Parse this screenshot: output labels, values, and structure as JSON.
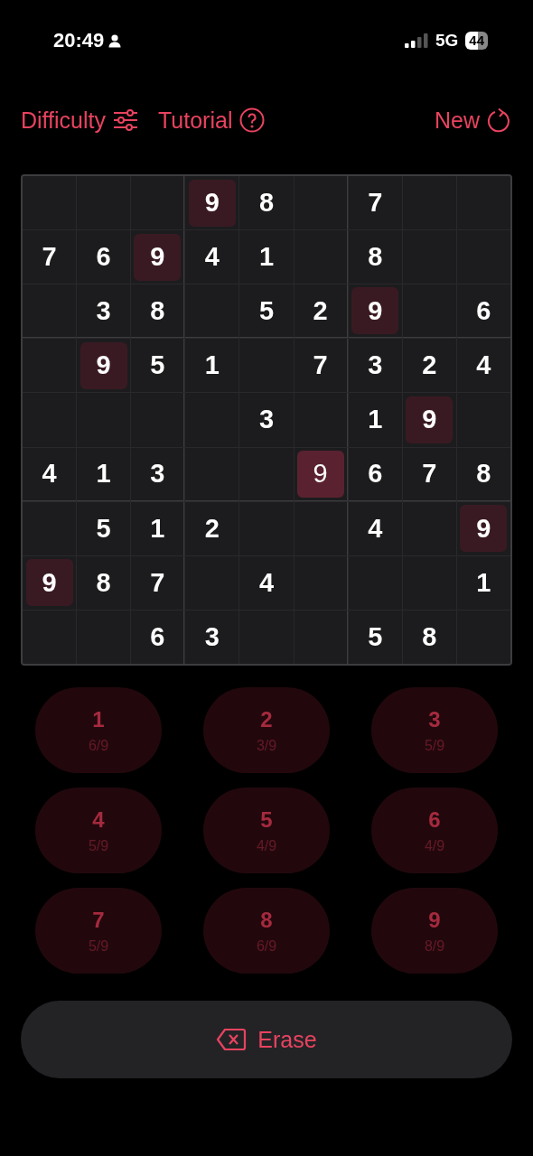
{
  "status_bar": {
    "time": "20:49",
    "network": "5G",
    "battery": "44"
  },
  "toolbar": [
    {
      "kind": "difficulty",
      "label": "Difficulty"
    },
    {
      "kind": "tutorial",
      "label": "Tutorial"
    },
    {
      "kind": "new",
      "label": "New"
    }
  ],
  "grid": [
    [
      {
        "kind": "empty"
      },
      {
        "kind": "empty"
      },
      {
        "kind": "empty"
      },
      {
        "digit": "9",
        "kind": "given",
        "highlighted": true
      },
      {
        "digit": "8",
        "kind": "given",
        "highlighted": false
      },
      {
        "kind": "empty"
      },
      {
        "digit": "7",
        "kind": "given",
        "highlighted": false
      },
      {
        "kind": "empty"
      },
      {
        "kind": "empty"
      }
    ],
    [
      {
        "digit": "7",
        "kind": "given",
        "highlighted": false
      },
      {
        "digit": "6",
        "kind": "given",
        "highlighted": false
      },
      {
        "digit": "9",
        "kind": "given",
        "highlighted": true
      },
      {
        "digit": "4",
        "kind": "given",
        "highlighted": false
      },
      {
        "digit": "1",
        "kind": "given",
        "highlighted": false
      },
      {
        "kind": "empty"
      },
      {
        "digit": "8",
        "kind": "given",
        "highlighted": false
      },
      {
        "kind": "empty"
      },
      {
        "kind": "empty"
      }
    ],
    [
      {
        "kind": "empty"
      },
      {
        "digit": "3",
        "kind": "given",
        "highlighted": false
      },
      {
        "digit": "8",
        "kind": "given",
        "highlighted": false
      },
      {
        "kind": "empty"
      },
      {
        "digit": "5",
        "kind": "given",
        "highlighted": false
      },
      {
        "digit": "2",
        "kind": "given",
        "highlighted": false
      },
      {
        "digit": "9",
        "kind": "given",
        "highlighted": true
      },
      {
        "kind": "empty"
      },
      {
        "digit": "6",
        "kind": "given",
        "highlighted": false
      }
    ],
    [
      {
        "kind": "empty"
      },
      {
        "digit": "9",
        "kind": "given",
        "highlighted": true
      },
      {
        "digit": "5",
        "kind": "given",
        "highlighted": false
      },
      {
        "digit": "1",
        "kind": "given",
        "highlighted": false
      },
      {
        "kind": "empty"
      },
      {
        "digit": "7",
        "kind": "given",
        "highlighted": false
      },
      {
        "digit": "3",
        "kind": "given",
        "highlighted": false
      },
      {
        "digit": "2",
        "kind": "given",
        "highlighted": false
      },
      {
        "digit": "4",
        "kind": "given",
        "highlighted": false
      }
    ],
    [
      {
        "kind": "empty"
      },
      {
        "kind": "empty"
      },
      {
        "kind": "empty"
      },
      {
        "kind": "empty"
      },
      {
        "digit": "3",
        "kind": "given",
        "highlighted": false
      },
      {
        "kind": "empty"
      },
      {
        "digit": "1",
        "kind": "given",
        "highlighted": false
      },
      {
        "digit": "9",
        "kind": "given",
        "highlighted": true
      },
      {
        "kind": "empty"
      }
    ],
    [
      {
        "digit": "4",
        "kind": "given",
        "highlighted": false
      },
      {
        "digit": "1",
        "kind": "given",
        "highlighted": false
      },
      {
        "digit": "3",
        "kind": "given",
        "highlighted": false
      },
      {
        "kind": "empty"
      },
      {
        "kind": "empty"
      },
      {
        "digit": "9",
        "kind": "entered",
        "highlighted": true
      },
      {
        "digit": "6",
        "kind": "given",
        "highlighted": false
      },
      {
        "digit": "7",
        "kind": "given",
        "highlighted": false
      },
      {
        "digit": "8",
        "kind": "given",
        "highlighted": false
      }
    ],
    [
      {
        "kind": "empty"
      },
      {
        "digit": "5",
        "kind": "given",
        "highlighted": false
      },
      {
        "digit": "1",
        "kind": "given",
        "highlighted": false
      },
      {
        "digit": "2",
        "kind": "given",
        "highlighted": false
      },
      {
        "kind": "empty"
      },
      {
        "kind": "empty"
      },
      {
        "digit": "4",
        "kind": "given",
        "highlighted": false
      },
      {
        "kind": "empty"
      },
      {
        "digit": "9",
        "kind": "given",
        "highlighted": true
      }
    ],
    [
      {
        "digit": "9",
        "kind": "given",
        "highlighted": true
      },
      {
        "digit": "8",
        "kind": "given",
        "highlighted": false
      },
      {
        "digit": "7",
        "kind": "given",
        "highlighted": false
      },
      {
        "kind": "empty"
      },
      {
        "digit": "4",
        "kind": "given",
        "highlighted": false
      },
      {
        "kind": "empty"
      },
      {
        "kind": "empty"
      },
      {
        "kind": "empty"
      },
      {
        "digit": "1",
        "kind": "given",
        "highlighted": false
      }
    ],
    [
      {
        "kind": "empty"
      },
      {
        "kind": "empty"
      },
      {
        "digit": "6",
        "kind": "given",
        "highlighted": false
      },
      {
        "digit": "3",
        "kind": "given",
        "highlighted": false
      },
      {
        "kind": "empty"
      },
      {
        "kind": "empty"
      },
      {
        "digit": "5",
        "kind": "given",
        "highlighted": false
      },
      {
        "digit": "8",
        "kind": "given",
        "highlighted": false
      },
      {
        "kind": "empty"
      }
    ]
  ],
  "keypad": [
    {
      "digit": "1",
      "count": "6/9",
      "disabled": true
    },
    {
      "digit": "2",
      "count": "3/9",
      "disabled": true
    },
    {
      "digit": "3",
      "count": "5/9",
      "disabled": true
    },
    {
      "digit": "4",
      "count": "5/9",
      "disabled": true
    },
    {
      "digit": "5",
      "count": "4/9",
      "disabled": true
    },
    {
      "digit": "6",
      "count": "4/9",
      "disabled": true
    },
    {
      "digit": "7",
      "count": "5/9",
      "disabled": true
    },
    {
      "digit": "8",
      "count": "6/9",
      "disabled": true
    },
    {
      "digit": "9",
      "count": "8/9",
      "disabled": true
    }
  ],
  "erase_button": {
    "label": "Erase"
  }
}
